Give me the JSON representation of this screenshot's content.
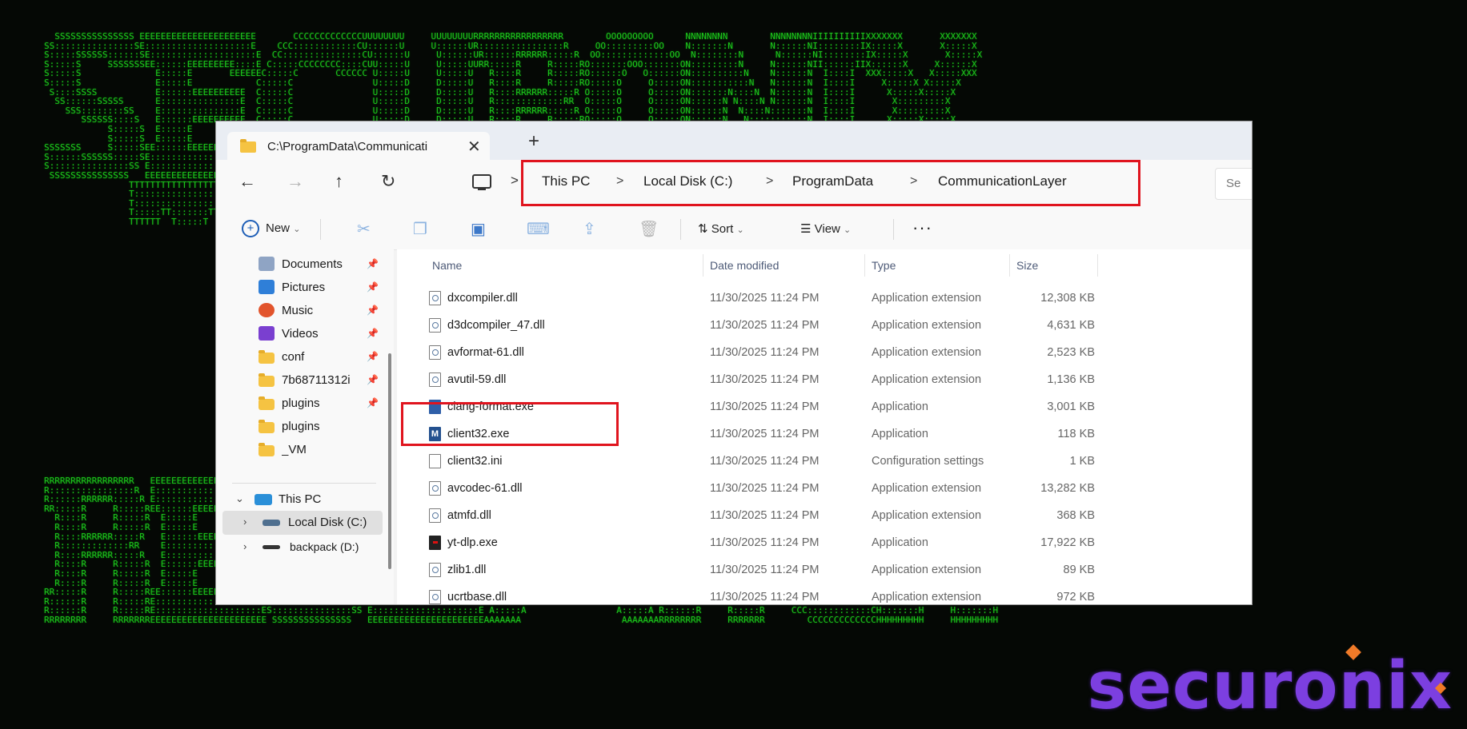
{
  "background": {
    "ascii_top": [
      "  SSSSSSSSSSSSSSS EEEEEEEEEEEEEEEEEEEEEE       CCCCCCCCCCCCCUUUUUUUU     UUUUUUUURRRRRRRRRRRRRRRRR        OOOOOOOOO      NNNNNNNN        NNNNNNNNIIIIIIIIIIXXXXXXX       XXXXXXX",
      "SS:::::::::::::::SE::::::::::::::::::::E    CCC::::::::::::CU::::::U     U::::::UR::::::::::::::::R     OO:::::::::OO    N:::::::N       N::::::NI::::::::IX:::::X       X:::::X",
      "S:::::SSSSSS::::::SE::::::::::::::::::::E  CC:::::::::::::::CU::::::U     U::::::UR::::::RRRRRR:::::R  OO:::::::::::::OO  N::::::::N      N::::::NI::::::::IX:::::X       X:::::X",
      "S:::::S     SSSSSSSEE::::::EEEEEEEEE::::E C:::::CCCCCCCC::::CUU:::::U     U:::::UURR:::::R     R:::::RO:::::::OOO:::::::ON:::::::::N     N::::::NII::::::IIX::::::X     X::::::X",
      "S:::::S              E:::::E       EEEEEEC:::::C       CCCCCC U:::::U     U:::::U   R::::R     R:::::RO::::::O   O::::::ON::::::::::N    N::::::N  I::::I  XXX:::::X   X:::::XXX",
      "S:::::S              E:::::E            C:::::C               U:::::D     D:::::U   R::::R     R:::::RO:::::O     O:::::ON:::::::::::N   N::::::N  I::::I     X:::::X X:::::X",
      " S::::SSSS           E::::::EEEEEEEEEE  C:::::C               U:::::D     D:::::U   R::::RRRRRR:::::R O:::::O     O:::::ON:::::::N::::N  N::::::N  I::::I      X:::::X:::::X",
      "  SS::::::SSSSS      E:::::::::::::::E  C:::::C               U:::::D     D:::::U   R:::::::::::::RR  O:::::O     O:::::ON::::::N N::::N N::::::N  I::::I       X:::::::::X",
      "    SSS::::::::SS    E:::::::::::::::E  C:::::C               U:::::D     D:::::U   R::::RRRRRR:::::R O:::::O     O:::::ON::::::N  N::::N:::::::N  I::::I       X:::::::::X",
      "       SSSSSS::::S   E::::::EEEEEEEEEE  C:::::C               U:::::D     D:::::U   R::::R     R:::::RO:::::O     O:::::ON::::::N   N:::::::::::N  I::::I      X:::::X:::::X",
      "            S:::::S  E:::::E            C:::::C               U:::::D     D:::::U   R::::R     R:::::RO:::::O     O:::::ON::::::N    N::::::::::N  I::::I     X:::::X X:::::X",
      "            S:::::S  E:::::E       EEEEEEC:::::C       CCCCCC U::::::U   U::::::U   R::::R     R:::::RO::::::O   O::::::ON::::::N     N:::::::::N  I::::I  XXX:::::X   X:::::XXX",
      "SSSSSSS     S:::::SEE::::::EEEEEEEE:::::E C:::::CCCCCCCC::::C U:::::::UUU:::::::U RR:::::R     R:::::RO:::::::OOO:::::::ON::::::N      N::::::::NII::::::IIX::::::X     X::::::X",
      "S::::::SSSSSS:::::SE::::::::::::::::::::E  CC:::::::::::::::C  UU:::::::::::::UU  R::::::R     R:::::R OO:::::::::::::OO N::::::N       N:::::::NI::::::::IX:::::X       X:::::X",
      "S:::::::::::::::SS E::::::::::::::::::::E    CCC::::::::::::C    UU:::::::::UU    R::::::R     R:::::R   OO:::::::::OO   N::::::N        N::::::NI::::::::IX:::::X       X:::::X",
      " SSSSSSSSSSSSSSS   EEEEEEEEEEEEEEEEEEEEEE       CCCCCCCCCCCCC      UUUUUUUUU      RRRRRRRR     RRRRRRR     OOOOOOOOO     NNNNNNNN         NNNNNNNIIIIIIIIIIXXXXXXX       XXXXXXX",
      "                TTTTTTTTTTTTTTTTTTTTTTT",
      "                T:::::::::::::::::::::T",
      "                T:::::::::::::::::::::T",
      "                T:::::TT:::::::TT:::::T",
      "                TTTTTT  T:::::T  TTTTTT"
    ],
    "ascii_bottom": [
      "RRRRRRRRRRRRRRRRR   EEEEEEEEEEEEEEEEEEEEEE   SSSSSSSSSSSSSSS EEEEEEEEEEEEEEEEEEEEEE               AAA               RRRRRRRRRRRRRRRRR        CCCCCCCCCCCCCHHHHHHHHH     HHHHHHHHH",
      "R::::::::::::::::R  E::::::::::::::::::::E SS:::::::::::::::SE::::::::::::::::::::E              A:::A              R::::::::::::::::R    CCC::::::::::::CH:::::::H     H:::::::H",
      "R::::::RRRRRR:::::R E::::::::::::::::::::ES:::::SSSSSS::::::SE::::::::::::::::::::E             A:::::A             R::::::RRRRRR:::::R CC:::::::::::::::CH:::::::H     H:::::::H",
      "RR:::::R     R:::::REE::::::EEEEEEEEE::::ES:::::S     SSSSSSSEE::::::EEEEEEEEE::::E            A:::::::A            RR:::::R     R:::::RC:::::CCCCCCCC::::CHH::::::H     H::::::HH",
      "  R::::R     R:::::R  E:::::E       EEEEEES:::::S              E:::::E       EEEEEE           A:::::::::A             R::::R     R:::::RC:::::C       CCCCCC  H:::::H     H:::::H",
      "  R::::R     R:::::R  E:::::E             S:::::S              E:::::E                       A:::::A:::::A            R::::R     R:::::RC:::::C                H:::::H     H:::::H",
      "  R::::RRRRRR:::::R   E::::::EEEEEEEEEE    S::::SSSS           E::::::EEEEEEEEEE            A:::::A A:::::A           R::::RRRRRR:::::R C:::::C                H::::::HHHHH::::::H",
      "  R:::::::::::::RR    E:::::::::::::::E     SS::::::SSSSS      E:::::::::::::::E           A:::::A   A:::::A          R:::::::::::::RR  C:::::C                H:::::::::::::::::H",
      "  R::::RRRRRR:::::R   E:::::::::::::::E       SSS::::::::SS    E:::::::::::::::E          A:::::A     A:::::A         R::::RRRRRR:::::R C:::::C                H:::::::::::::::::H",
      "  R::::R     R:::::R  E::::::EEEEEEEEEE          SSSSSS::::S   E::::::EEEEEEEEEE         A:::::AAAAAAAAA:::::A        R::::R     R:::::RC:::::C                H::::::HHHHH::::::H",
      "  R::::R     R:::::R  E:::::E                         S:::::S  E:::::E                  A:::::::::::::::::::::A       R::::R     R:::::RC:::::C                H:::::H     H:::::H",
      "  R::::R     R:::::R  E:::::E       EEEEEE            S:::::S  E:::::E       EEEEEE    A:::::AAAAAAAAAAAAA:::::A      R::::R     R:::::R C:::::C       CCCCCC  H:::::H     H:::::H",
      "RR:::::R     R:::::REE::::::EEEEEEEE:::::ESSSSSSS     S:::::SEE::::::EEEEEEEE:::::E   A:::::A             A:::::A   RR:::::R     R:::::R  C:::::CCCCCCCC::::CHH::::::H     H::::::HH",
      "R::::::R     R:::::RE::::::::::::::::::::ES::::::SSSSSS:::::SE::::::::::::::::::::E  A:::::A               A:::::A  R::::::R     R:::::R   CC:::::::::::::::CH:::::::H     H:::::::H",
      "R::::::R     R:::::RE::::::::::::::::::::ES:::::::::::::::SS E::::::::::::::::::::E A:::::A                 A:::::A R::::::R     R:::::R     CCC::::::::::::CH:::::::H     H:::::::H",
      "RRRRRRRR     RRRRRRREEEEEEEEEEEEEEEEEEEEEE SSSSSSSSSSSSSSS   EEEEEEEEEEEEEEEEEEEEEEAAAAAAA                   AAAAAAARRRRRRRR     RRRRRRR        CCCCCCCCCCCCCHHHHHHHHH     HHHHHHHHH"
    ],
    "brand": "securonix",
    "ascii_color": "#1fd81f",
    "brand_color": "#7c3fe0"
  },
  "window": {
    "tab_title": "C:\\ProgramData\\Communicati",
    "tab_close": "✕",
    "new_tab": "+",
    "nav": {
      "back": "←",
      "forward": "→",
      "up": "↑",
      "refresh": "↻",
      "crumb_sep": ">"
    },
    "breadcrumb": [
      "This PC",
      "Local Disk (C:)",
      "ProgramData",
      "CommunicationLayer"
    ],
    "search_partial": "Se",
    "toolbar": {
      "new_label": "New",
      "sort_label": "Sort",
      "view_label": "View",
      "more": "···"
    },
    "sidebar": {
      "quick": [
        {
          "label": "Documents",
          "icon": "documents-icon",
          "pinned": true
        },
        {
          "label": "Pictures",
          "icon": "pictures-icon",
          "pinned": true
        },
        {
          "label": "Music",
          "icon": "music-icon",
          "pinned": true
        },
        {
          "label": "Videos",
          "icon": "videos-icon",
          "pinned": true
        },
        {
          "label": "conf",
          "icon": "folder-icon",
          "pinned": true
        },
        {
          "label": "7b68711312i",
          "icon": "folder-icon",
          "pinned": true
        },
        {
          "label": "plugins",
          "icon": "folder-icon",
          "pinned": true
        },
        {
          "label": "plugins",
          "icon": "folder-icon",
          "pinned": false
        },
        {
          "label": "_VM",
          "icon": "folder-icon",
          "pinned": false
        }
      ],
      "this_pc": "This PC",
      "local_disk": "Local Disk (C:)",
      "backpack": "backpack (D:)"
    },
    "columns": {
      "name": "Name",
      "date": "Date modified",
      "type": "Type",
      "size": "Size"
    },
    "files": [
      {
        "name": "dxcompiler.dll",
        "date": "11/30/2025 11:24 PM",
        "type": "Application extension",
        "size": "12,308 KB",
        "icon": "dll"
      },
      {
        "name": "d3dcompiler_47.dll",
        "date": "11/30/2025 11:24 PM",
        "type": "Application extension",
        "size": "4,631 KB",
        "icon": "dll"
      },
      {
        "name": "avformat-61.dll",
        "date": "11/30/2025 11:24 PM",
        "type": "Application extension",
        "size": "2,523 KB",
        "icon": "dll"
      },
      {
        "name": "avutil-59.dll",
        "date": "11/30/2025 11:24 PM",
        "type": "Application extension",
        "size": "1,136 KB",
        "icon": "dll"
      },
      {
        "name": "clang-format.exe",
        "date": "11/30/2025 11:24 PM",
        "type": "Application",
        "size": "3,001 KB",
        "icon": "exe"
      },
      {
        "name": "client32.exe",
        "date": "11/30/2025 11:24 PM",
        "type": "Application",
        "size": "118 KB",
        "icon": "m"
      },
      {
        "name": "client32.ini",
        "date": "11/30/2025 11:24 PM",
        "type": "Configuration settings",
        "size": "1 KB",
        "icon": "ini"
      },
      {
        "name": "avcodec-61.dll",
        "date": "11/30/2025 11:24 PM",
        "type": "Application extension",
        "size": "13,282 KB",
        "icon": "dll"
      },
      {
        "name": "atmfd.dll",
        "date": "11/30/2025 11:24 PM",
        "type": "Application extension",
        "size": "368 KB",
        "icon": "dll"
      },
      {
        "name": "yt-dlp.exe",
        "date": "11/30/2025 11:24 PM",
        "type": "Application",
        "size": "17,922 KB",
        "icon": "yt"
      },
      {
        "name": "zlib1.dll",
        "date": "11/30/2025 11:24 PM",
        "type": "Application extension",
        "size": "89 KB",
        "icon": "dll"
      },
      {
        "name": "ucrtbase.dll",
        "date": "11/30/2025 11:24 PM",
        "type": "Application extension",
        "size": "972 KB",
        "icon": "dll"
      }
    ],
    "highlight_color": "#e0141e"
  }
}
